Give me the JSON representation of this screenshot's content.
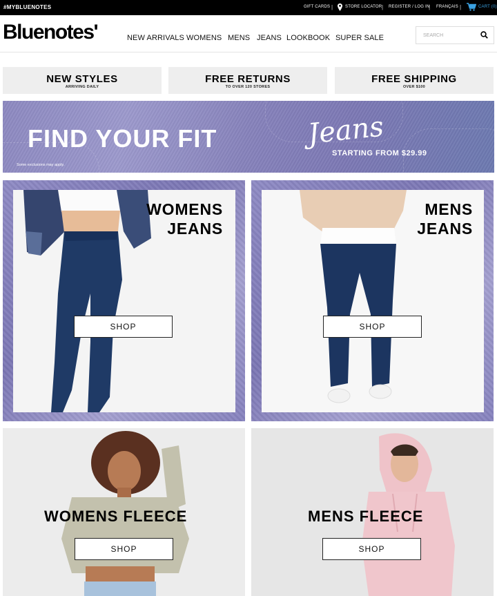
{
  "topbar": {
    "hashtag": "#MYBLUENOTES",
    "gift_cards": "GIFT CARDS",
    "store_locator": "STORE LOCATOR",
    "register": "REGISTER / LOG IN",
    "language": "FRANÇAIS",
    "cart": "CART (0)",
    "separator": "|"
  },
  "header": {
    "logo": "Bluenotes'",
    "nav": [
      "NEW ARRIVALS",
      "WOMENS",
      "MENS",
      "JEANS",
      "LOOKBOOK",
      "SUPER SALE"
    ],
    "search_placeholder": "SEARCH"
  },
  "promos": [
    {
      "title": "NEW STYLES",
      "subtitle": "ARRIVING DAILY"
    },
    {
      "title": "FREE RETURNS",
      "subtitle": "TO OVER 120 STORES"
    },
    {
      "title": "FREE SHIPPING",
      "subtitle": "OVER $100"
    }
  ],
  "hero": {
    "headline": "FIND YOUR FIT",
    "script": "Jeans",
    "price": "STARTING FROM $29.99",
    "disclaimer": "Some exclusions may apply."
  },
  "tiles": {
    "womens_jeans": {
      "line1": "WOMENS",
      "line2": "JEANS",
      "button": "SHOP"
    },
    "mens_jeans": {
      "line1": "MENS",
      "line2": "JEANS",
      "button": "SHOP"
    },
    "womens_fleece": {
      "title": "WOMENS FLEECE",
      "button": "SHOP"
    },
    "mens_fleece": {
      "title": "MENS FLEECE",
      "button": "SHOP"
    }
  },
  "colors": {
    "cart_accent": "#3aa0e0",
    "denim_purple": "#8682bb",
    "promo_bg": "#eeeeee"
  }
}
